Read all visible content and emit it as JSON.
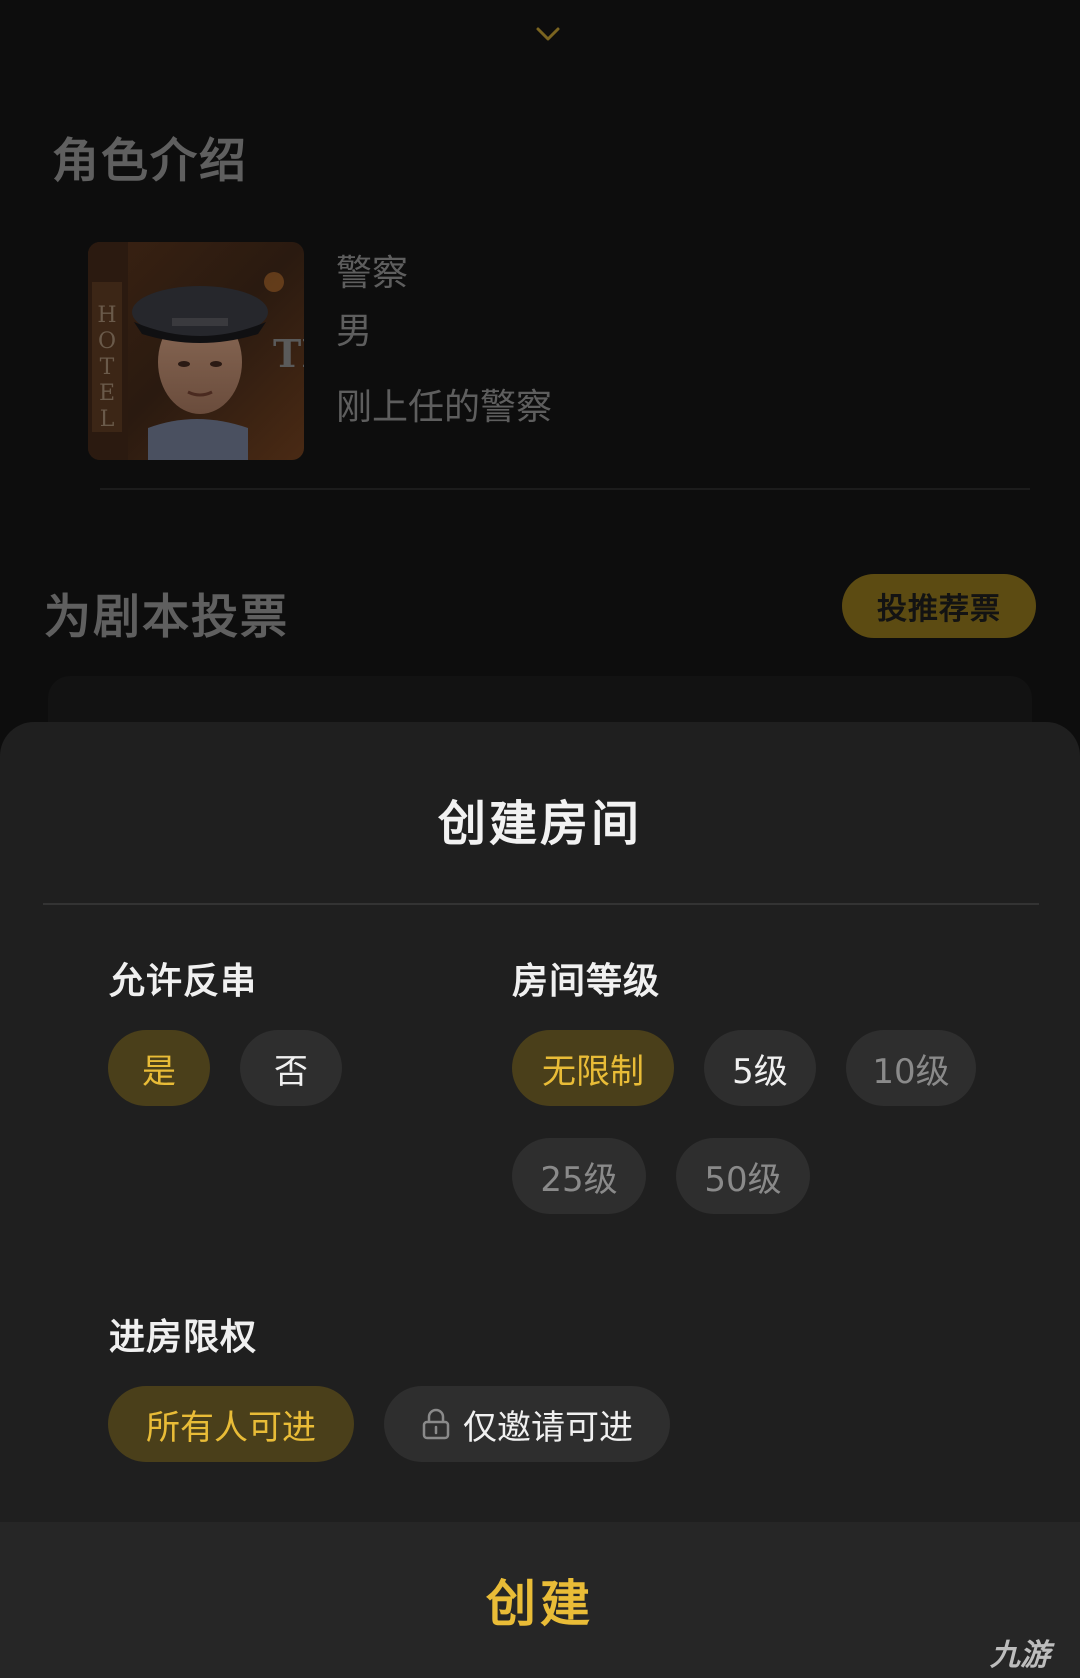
{
  "background": {
    "role_section_title": "角色介绍",
    "role": {
      "name": "警察",
      "gender": "男",
      "description": "刚上任的警察"
    },
    "vote_section_title": "为剧本投票",
    "vote_button_label": "投推荐票"
  },
  "sheet": {
    "title": "创建房间",
    "allow_counter": {
      "label": "允许反串",
      "options": [
        "是",
        "否"
      ],
      "selected": "是"
    },
    "room_level": {
      "label": "房间等级",
      "options": [
        "无限制",
        "5级",
        "10级",
        "25级",
        "50级"
      ],
      "selected": "无限制"
    },
    "access": {
      "label": "进房限权",
      "options": [
        "所有人可进",
        "仅邀请可进"
      ],
      "selected": "所有人可进"
    },
    "create_label": "创建"
  },
  "watermark": "九游",
  "colors": {
    "accent": "#e9bc37",
    "selected_chip_bg": "#4a3f1a",
    "chip_bg": "#2e2e2e",
    "sheet_bg": "#1f1f1f"
  },
  "icons": [
    "chevron-down-icon",
    "lock-icon",
    "police-avatar-image"
  ]
}
